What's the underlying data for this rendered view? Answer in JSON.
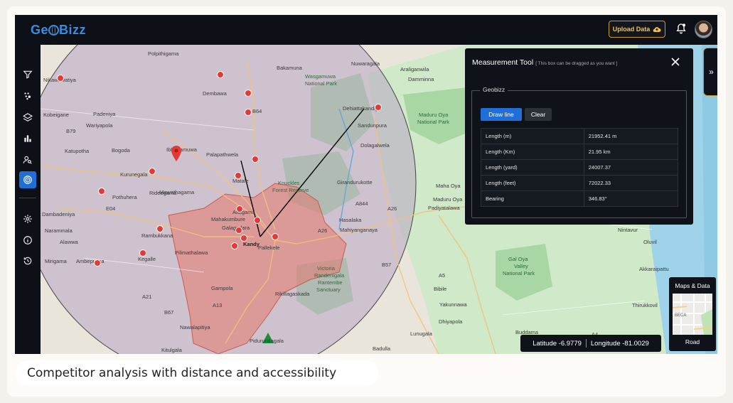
{
  "app": {
    "logo": "GeoBizz",
    "logo_parts": [
      "Ge",
      "Bizz"
    ],
    "upload_label": "Upload Data",
    "icons": {
      "upload": "cloud-upload-icon",
      "bell": "bell-icon",
      "avatar": "user-avatar"
    }
  },
  "sidebar": {
    "items": [
      {
        "icon": "filter-icon"
      },
      {
        "icon": "heatmap-icon"
      },
      {
        "icon": "layers-icon"
      },
      {
        "icon": "bar-chart-icon"
      },
      {
        "icon": "user-search-icon"
      },
      {
        "icon": "target-icon",
        "active": true
      },
      {
        "icon": "settings-icon"
      },
      {
        "icon": "info-icon"
      },
      {
        "icon": "history-icon"
      }
    ]
  },
  "map": {
    "labels": [
      "Polpithigama",
      "Bakamuna",
      "Nuwaragala",
      "Araliganwila",
      "Nikawewatiya",
      "Wasgamuwa",
      "National Park",
      "Damminna",
      "Dembawa",
      "B64",
      "Dehiattakandiya",
      "Kobeigane",
      "Padeniya",
      "Maduru Oya",
      "National Park",
      "Wariyapola",
      "Sandunpura",
      "B79",
      "Dolagalwela",
      "Katupotha",
      "Bogoda",
      "Ibbagamuwa",
      "Palapathwela",
      "Kurunegala",
      "Matale",
      "Knuckles",
      "Forest Reserve",
      "Girandurukotte",
      "Maha Oya",
      "Rideegama",
      "Mawathagama",
      "Pothuhera",
      "A844",
      "Maduru Oya",
      "Padiyatalawa",
      "Dambadeniya",
      "E04",
      "Alutgama",
      "Mahakumbure",
      "A26",
      "A26",
      "Hasalaka",
      "Narammala",
      "Galagedara",
      "Kandy",
      "Pallekele",
      "Mahiyanganaya",
      "Alawwa",
      "Rambukkana",
      "Pilimathalawa",
      "Nintavur",
      "Mirigama",
      "Ambepussa",
      "Kegalle",
      "Victoria",
      "Randenigala",
      "Rantembe",
      "Sanctuary",
      "Oluvil",
      "Gal Oya",
      "Valley",
      "National Park",
      "Akkaraipattu",
      "B57",
      "A5",
      "Bibile",
      "Gampola",
      "Rikillagaskada",
      "A21",
      "A13",
      "Yakunnawa",
      "Thirukkovil",
      "B67",
      "Nawalapitiya",
      "Dhiyapola",
      "Lunugala",
      "Kitulgala",
      "Pidurutalagala",
      "Badulla",
      "Buddama",
      "A4"
    ]
  },
  "measurement_tool": {
    "title": "Measurement Tool",
    "hint": "[ This box can be dragged as you want ]",
    "group_label": "Geobizz",
    "draw_label": "Draw line",
    "clear_label": "Clear",
    "rows": [
      {
        "label": "Length (m)",
        "value": "21952.41 m"
      },
      {
        "label": "Length (Km)",
        "value": "21.95 km"
      },
      {
        "label": "Length (yard)",
        "value": "24007.37"
      },
      {
        "label": "Length (feet)",
        "value": "72022.33"
      },
      {
        "label": "Bearing",
        "value": "346.83°"
      }
    ]
  },
  "coords": {
    "latitude": "Latitude -6.9779",
    "longitude": "Longitude -81.0029"
  },
  "maps_data": {
    "title": "Maps & Data",
    "mode": "Road",
    "thumb_text": "BECA"
  },
  "caption": "Competitor analysis with distance and accessibility",
  "colors": {
    "accent": "#1f6fd6",
    "gold": "#c99b2d",
    "pin": "#e53935",
    "panel": "#0f1218"
  }
}
